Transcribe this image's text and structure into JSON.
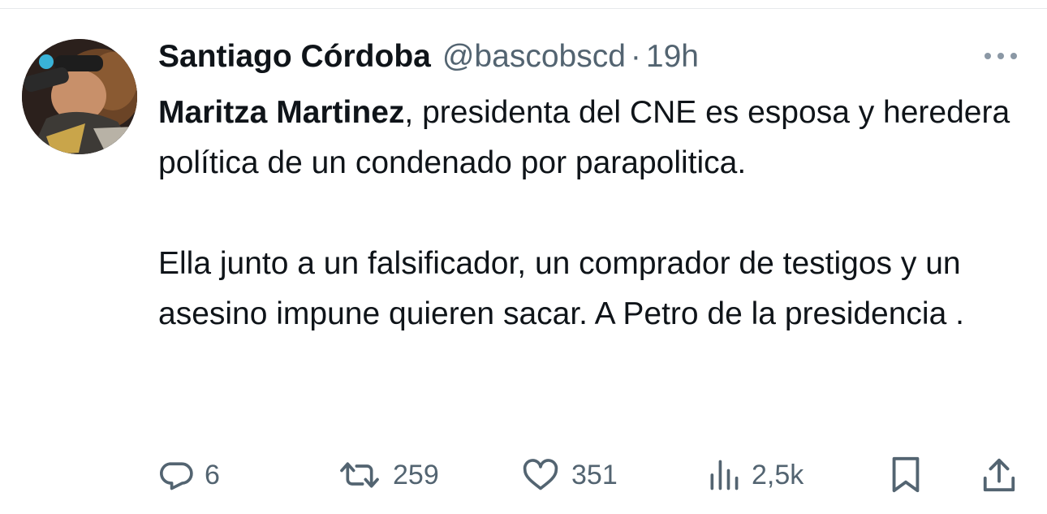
{
  "tweet": {
    "author": {
      "display_name": "Santiago Córdoba",
      "handle": "@bascobscd",
      "separator": "·",
      "timestamp": "19h"
    },
    "body": {
      "mention": "Maritza Martinez",
      "paragraph1_rest": ", presidenta del CNE es esposa y heredera política de un condenado por parapolitica.",
      "paragraph2": "Ella junto a un falsificador, un comprador de testigos y un asesino impune quieren sacar. A Petro de la presidencia ."
    },
    "actions": {
      "replies": "6",
      "reposts": "259",
      "likes": "351",
      "views": "2,5k"
    },
    "icons": {
      "more": "more-horizontal-icon",
      "reply": "reply-bubble-icon",
      "repost": "repost-arrows-icon",
      "like": "heart-icon",
      "views": "bar-chart-icon",
      "bookmark": "bookmark-icon",
      "share": "share-upload-icon"
    },
    "colors": {
      "text": "#0f1419",
      "secondary": "#536471",
      "divider": "#e6e9ec"
    }
  }
}
